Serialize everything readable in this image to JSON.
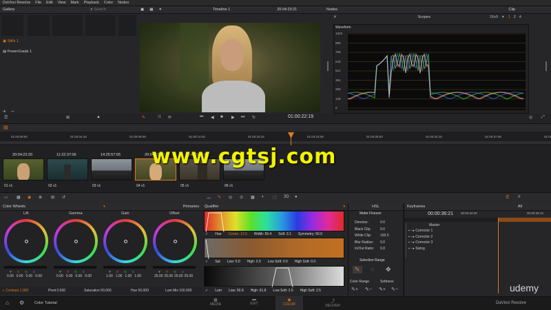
{
  "app": {
    "title": "DaVinci Resolve"
  },
  "menu": [
    "File",
    "Edit",
    "View",
    "Mark",
    "Playback",
    "Color",
    "Nodes"
  ],
  "gallery": {
    "title": "Gallery",
    "search_placeholder": "Search",
    "albums": [
      "Stills 1",
      "PowerGrade 1"
    ]
  },
  "viewer": {
    "timeline_name": "Timeline 1",
    "timecode_top": "20:04:23:21",
    "timecode": "01:00:22:19"
  },
  "nodes": {
    "title": "Nodes"
  },
  "scopes": {
    "title": "Scopes",
    "scope_type": "Waveform",
    "aspect": "16x9",
    "pages": [
      "1",
      "2",
      "4"
    ],
    "y_ticks": [
      "1023",
      "896",
      "768",
      "640",
      "512",
      "384",
      "256",
      "128",
      "0"
    ]
  },
  "clip_label": "Clip",
  "timeline_ruler": [
    "01:00:00:00",
    "01:00:04:16",
    "01:00:09:08",
    "01:00:14:00",
    "01:00:18:16",
    "01:00:23:08",
    "01:00:28:00",
    "01:00:32:16",
    "01:00:37:08",
    "01:00:42:00"
  ],
  "clips": [
    {
      "tc": "20:04:22:20",
      "label": "01  v1"
    },
    {
      "tc": "11:22:37:06",
      "label": "02  v1"
    },
    {
      "tc": "14:25:57:05",
      "label": "03  v1"
    },
    {
      "tc": "20:04:22:20",
      "label": "04  v1"
    },
    {
      "tc": "14:25:57:05",
      "label": "05  v1"
    },
    {
      "tc": "",
      "label": "06  v1"
    }
  ],
  "watermark": "www.cgtsj.com",
  "color_wheels": {
    "title": "Color Wheels",
    "mode": "Primaries",
    "wheels": [
      {
        "name": "Lift",
        "vals": [
          "0.00",
          "0.00",
          "0.00",
          "0.00"
        ]
      },
      {
        "name": "Gamma",
        "vals": [
          "0.00",
          "0.00",
          "0.00",
          "0.00"
        ]
      },
      {
        "name": "Gain",
        "vals": [
          "1.00",
          "1.00",
          "1.00",
          "1.00"
        ]
      },
      {
        "name": "Offset",
        "vals": [
          "25.00",
          "25.00",
          "25.00",
          "25.00"
        ]
      }
    ],
    "channels": [
      "Y",
      "R",
      "G",
      "B"
    ],
    "bottom": {
      "contrast": "Contrast 1.000",
      "pivot": "Pivot 0.500",
      "saturation": "Saturation 50.000",
      "hue": "Hue 50.000",
      "lummix": "Lum Mix 100.000"
    }
  },
  "qualifier": {
    "title": "Qualifier",
    "mode": "HSL",
    "hue": {
      "label": "Hue",
      "center": "Center: 12.5",
      "width": "Width: 55.4",
      "soft": "Soft: 3.1",
      "sym": "Symmetry: 50.0"
    },
    "sat": {
      "label": "Sat",
      "low": "Low: 0.0",
      "high": "High: 2.9",
      "lowsoft": "Low Soft: 0.0",
      "highsoft": "High Soft: 0.0"
    },
    "lum": {
      "label": "Lum",
      "low": "Low: 50.9",
      "high": "High: 61.8",
      "lowsoft": "Low Soft: 2.5",
      "highsoft": "High Soft: 2.5"
    }
  },
  "matte": {
    "title": "Matte Finesse",
    "rows": [
      [
        "Denoise:",
        "0.0"
      ],
      [
        "Black Clip:",
        "0.0"
      ],
      [
        "White Clip:",
        "100.0"
      ],
      [
        "Blur Radius:",
        "0.0"
      ],
      [
        "In/Out Ratio:",
        "0.0"
      ]
    ],
    "selection_range": "Selection Range",
    "color_range": "Color Range",
    "softness": "Softness"
  },
  "keyframes": {
    "title": "Keyframes",
    "filter": "All",
    "tc": "00:00:36:21",
    "t1": "00:00:34:20",
    "t2": "00:00:36:13",
    "master": "Master",
    "tracks": [
      "Corrector 1",
      "Corrector 2",
      "Corrector 3",
      "Sizing"
    ]
  },
  "footer": {
    "project": "Color Tutorial",
    "brand": "DaVinci Resolve",
    "tabs": [
      "MEDIA",
      "EDIT",
      "COLOR",
      "DELIVER"
    ]
  },
  "udemy": "udemy",
  "colors": {
    "accent": "#e07a1f",
    "bg": "#1b1b1c",
    "panel": "#262628"
  }
}
